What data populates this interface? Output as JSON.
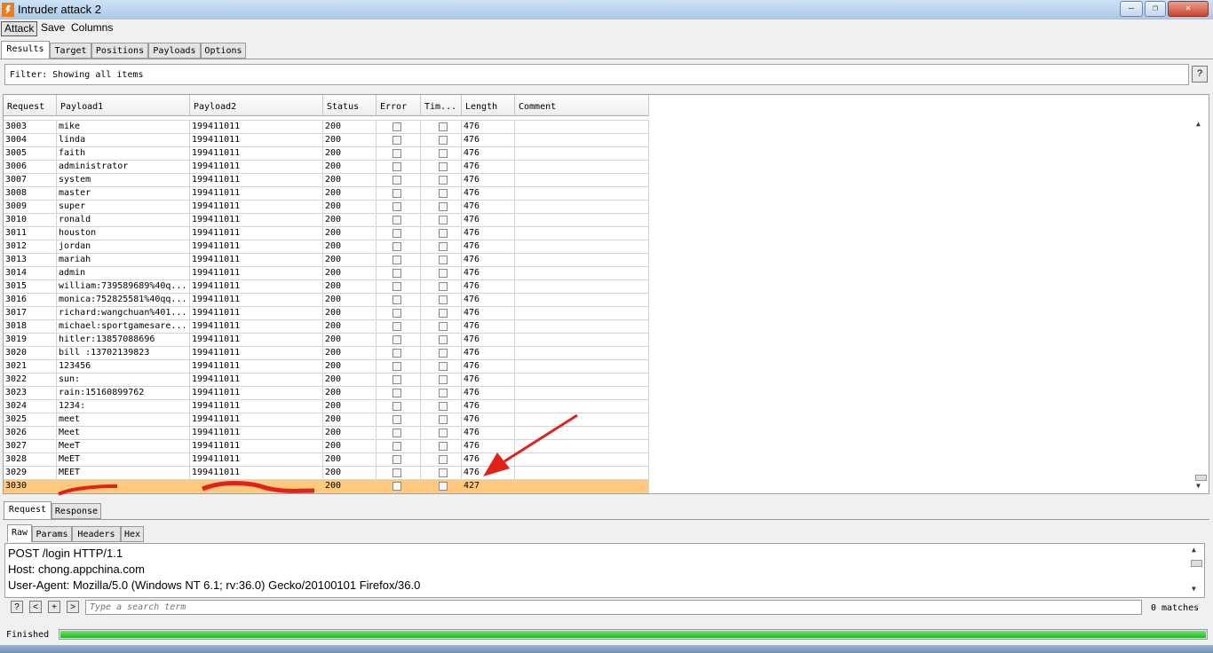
{
  "window": {
    "title": "Intruder attack 2",
    "minimize": "‒",
    "maximize": "❐",
    "close": "✕"
  },
  "menubar": {
    "items": [
      "Attack",
      "Save",
      "Columns"
    ]
  },
  "top_tabs": [
    "Results",
    "Target",
    "Positions",
    "Payloads",
    "Options"
  ],
  "filter": {
    "text": "Filter: Showing all items",
    "help": "?"
  },
  "table": {
    "columns": [
      "Request",
      "Payload1",
      "Payload2",
      "Status",
      "Error",
      "Tim...",
      "Length",
      "Comment"
    ],
    "rows": [
      {
        "req": "3003",
        "p1": "mike",
        "p2": "199411011",
        "status": "200",
        "length": "476",
        "comment": ""
      },
      {
        "req": "3004",
        "p1": "linda",
        "p2": "199411011",
        "status": "200",
        "length": "476",
        "comment": ""
      },
      {
        "req": "3005",
        "p1": "faith",
        "p2": "199411011",
        "status": "200",
        "length": "476",
        "comment": ""
      },
      {
        "req": "3006",
        "p1": "administrator",
        "p2": "199411011",
        "status": "200",
        "length": "476",
        "comment": ""
      },
      {
        "req": "3007",
        "p1": "system",
        "p2": "199411011",
        "status": "200",
        "length": "476",
        "comment": ""
      },
      {
        "req": "3008",
        "p1": "master",
        "p2": "199411011",
        "status": "200",
        "length": "476",
        "comment": ""
      },
      {
        "req": "3009",
        "p1": "super",
        "p2": "199411011",
        "status": "200",
        "length": "476",
        "comment": ""
      },
      {
        "req": "3010",
        "p1": "ronald",
        "p2": "199411011",
        "status": "200",
        "length": "476",
        "comment": ""
      },
      {
        "req": "3011",
        "p1": "houston",
        "p2": "199411011",
        "status": "200",
        "length": "476",
        "comment": ""
      },
      {
        "req": "3012",
        "p1": "jordan",
        "p2": "199411011",
        "status": "200",
        "length": "476",
        "comment": ""
      },
      {
        "req": "3013",
        "p1": "mariah",
        "p2": "199411011",
        "status": "200",
        "length": "476",
        "comment": ""
      },
      {
        "req": "3014",
        "p1": "admin",
        "p2": "199411011",
        "status": "200",
        "length": "476",
        "comment": ""
      },
      {
        "req": "3015",
        "p1": "william:739589689%40q...",
        "p2": "199411011",
        "status": "200",
        "length": "476",
        "comment": ""
      },
      {
        "req": "3016",
        "p1": "monica:752825581%40qq...",
        "p2": "199411011",
        "status": "200",
        "length": "476",
        "comment": ""
      },
      {
        "req": "3017",
        "p1": "richard:wangchuan%401...",
        "p2": "199411011",
        "status": "200",
        "length": "476",
        "comment": ""
      },
      {
        "req": "3018",
        "p1": "michael:sportgamesare...",
        "p2": "199411011",
        "status": "200",
        "length": "476",
        "comment": ""
      },
      {
        "req": "3019",
        "p1": "hitler:13857088696",
        "p2": "199411011",
        "status": "200",
        "length": "476",
        "comment": ""
      },
      {
        "req": "3020",
        "p1": "bill  :13702139823",
        "p2": "199411011",
        "status": "200",
        "length": "476",
        "comment": ""
      },
      {
        "req": "3021",
        "p1": "123456",
        "p2": "199411011",
        "status": "200",
        "length": "476",
        "comment": ""
      },
      {
        "req": "3022",
        "p1": "sun:",
        "p2": "199411011",
        "status": "200",
        "length": "476",
        "comment": ""
      },
      {
        "req": "3023",
        "p1": "rain:15160899762",
        "p2": "199411011",
        "status": "200",
        "length": "476",
        "comment": ""
      },
      {
        "req": "3024",
        "p1": "1234:",
        "p2": "199411011",
        "status": "200",
        "length": "476",
        "comment": ""
      },
      {
        "req": "3025",
        "p1": "meet",
        "p2": "199411011",
        "status": "200",
        "length": "476",
        "comment": ""
      },
      {
        "req": "3026",
        "p1": "Meet",
        "p2": "199411011",
        "status": "200",
        "length": "476",
        "comment": ""
      },
      {
        "req": "3027",
        "p1": "MeeT",
        "p2": "199411011",
        "status": "200",
        "length": "476",
        "comment": ""
      },
      {
        "req": "3028",
        "p1": "MeET",
        "p2": "199411011",
        "status": "200",
        "length": "476",
        "comment": ""
      },
      {
        "req": "3029",
        "p1": "MEET",
        "p2": "199411011",
        "status": "200",
        "length": "476",
        "comment": ""
      },
      {
        "req": "3030",
        "p1": "",
        "p2": "",
        "status": "200",
        "length": "427",
        "comment": ""
      }
    ],
    "selected_request": "3030"
  },
  "bottom_tabs": [
    "Request",
    "Response"
  ],
  "sub_tabs": [
    "Raw",
    "Params",
    "Headers",
    "Hex"
  ],
  "raw": {
    "lines": [
      "POST /login HTTP/1.1",
      "Host: chong.appchina.com",
      "User-Agent: Mozilla/5.0 (Windows NT 6.1; rv:36.0) Gecko/20100101 Firefox/36.0"
    ]
  },
  "search": {
    "help": "?",
    "prev": "<",
    "add": "+",
    "next": ">",
    "placeholder": "Type a search term",
    "matches": "0 matches"
  },
  "status": {
    "text": "Finished",
    "progress": 1.0
  },
  "colors": {
    "selected_row": "#ffc87a",
    "progress": "#1cbd1c",
    "annotation": "#e0221a"
  }
}
